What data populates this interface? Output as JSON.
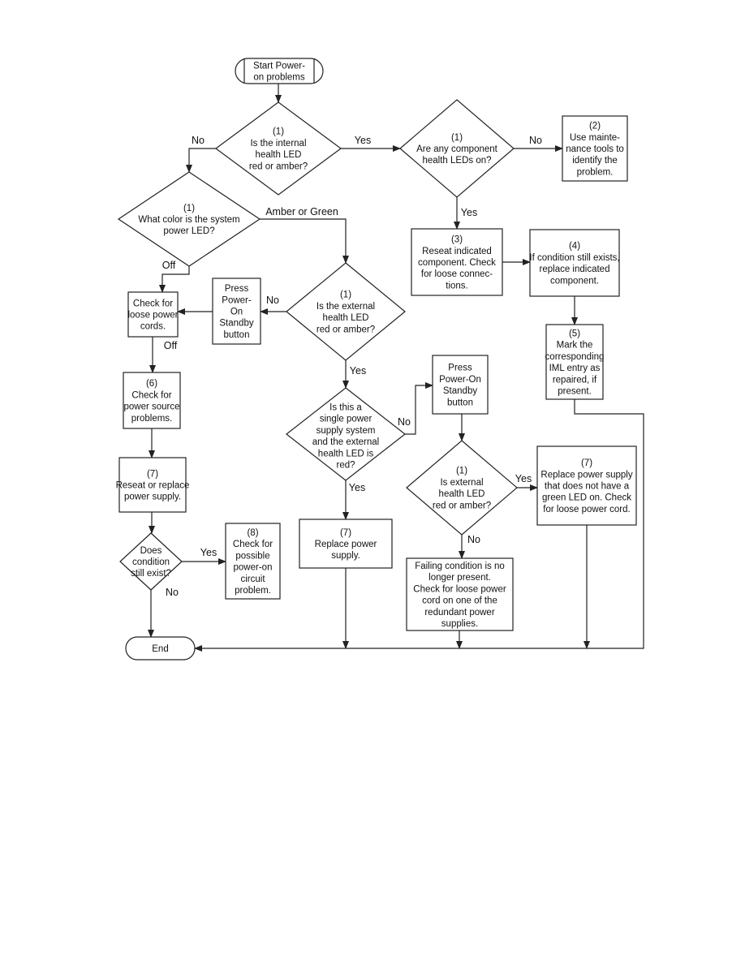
{
  "nodes": {
    "start": {
      "shape": "terminal",
      "lines": [
        "Start Power-",
        "on problems"
      ]
    },
    "d_internal": {
      "shape": "decision",
      "lines": [
        "(1)",
        "Is the internal",
        "health LED",
        "red or amber?"
      ]
    },
    "d_component": {
      "shape": "decision",
      "lines": [
        "(1)",
        "Are any component",
        "health LEDs on?"
      ]
    },
    "b_maint": {
      "shape": "process",
      "lines": [
        "(2)",
        "Use mainte-",
        "nance tools to",
        "identify the",
        "problem."
      ]
    },
    "d_syspower": {
      "shape": "decision",
      "lines": [
        "(1)",
        "What color is the system",
        "power LED?"
      ]
    },
    "b_reseat": {
      "shape": "process",
      "lines": [
        "(3)",
        "Reseat indicated",
        "component. Check",
        "for loose connec-",
        "tions."
      ]
    },
    "b_replace_comp": {
      "shape": "process",
      "lines": [
        "(4)",
        "If condition still exists,",
        "replace indicated",
        "component."
      ]
    },
    "d_external": {
      "shape": "decision",
      "lines": [
        "(1)",
        "Is the external",
        "health LED",
        "red or amber?"
      ]
    },
    "b_press_a": {
      "shape": "process",
      "lines": [
        "Press",
        "Power-",
        "On",
        "Standby",
        "button"
      ]
    },
    "b_check_cords": {
      "shape": "process",
      "lines": [
        "Check for",
        "loose power",
        "cords."
      ]
    },
    "b_mark_iml": {
      "shape": "process",
      "lines": [
        "(5)",
        "Mark the",
        "corresponding",
        "IML entry as",
        "repaired, if",
        "present."
      ]
    },
    "b_power_source": {
      "shape": "process",
      "lines": [
        "(6)",
        "Check for",
        "power source",
        "problems."
      ]
    },
    "d_single": {
      "shape": "decision",
      "lines": [
        "Is this a",
        "single power",
        "supply system",
        "and the external",
        "health LED is",
        "red?"
      ]
    },
    "b_press_b": {
      "shape": "process",
      "lines": [
        "Press",
        "Power-On",
        "Standby",
        "button"
      ]
    },
    "d_ext2": {
      "shape": "decision",
      "lines": [
        "(1)",
        "Is external",
        "health LED",
        "red or amber?"
      ]
    },
    "b_replace_ps_green": {
      "shape": "process",
      "lines": [
        "(7)",
        "Replace power supply",
        "that does not have a",
        "green LED on. Check",
        "for loose power cord."
      ]
    },
    "b_reseat_ps": {
      "shape": "process",
      "lines": [
        "(7)",
        "Reseat or replace",
        "power supply."
      ]
    },
    "d_exists": {
      "shape": "decision",
      "lines": [
        "Does",
        "condition",
        "still exist?"
      ]
    },
    "b_circuit": {
      "shape": "process",
      "lines": [
        "(8)",
        "Check for",
        "possible",
        "power-on",
        "circuit",
        "problem."
      ]
    },
    "b_replace_ps": {
      "shape": "process",
      "lines": [
        "(7)",
        "Replace power",
        "supply."
      ]
    },
    "b_failing": {
      "shape": "process",
      "lines": [
        "Failing condition is no",
        "longer present.",
        "Check for loose power",
        "cord on one of the",
        "redundant power",
        "supplies."
      ]
    },
    "end": {
      "shape": "terminal",
      "lines": [
        "End"
      ]
    }
  },
  "edge_labels": {
    "internal_no": "No",
    "internal_yes": "Yes",
    "component_no": "No",
    "component_yes": "Yes",
    "syspower_amber_green": "Amber or Green",
    "syspower_off": "Off",
    "external_no": "No",
    "cords_off": "Off",
    "external_yes": "Yes",
    "single_no": "No",
    "single_yes": "Yes",
    "ext2_yes": "Yes",
    "ext2_no": "No",
    "exists_yes": "Yes",
    "exists_no": "No"
  }
}
